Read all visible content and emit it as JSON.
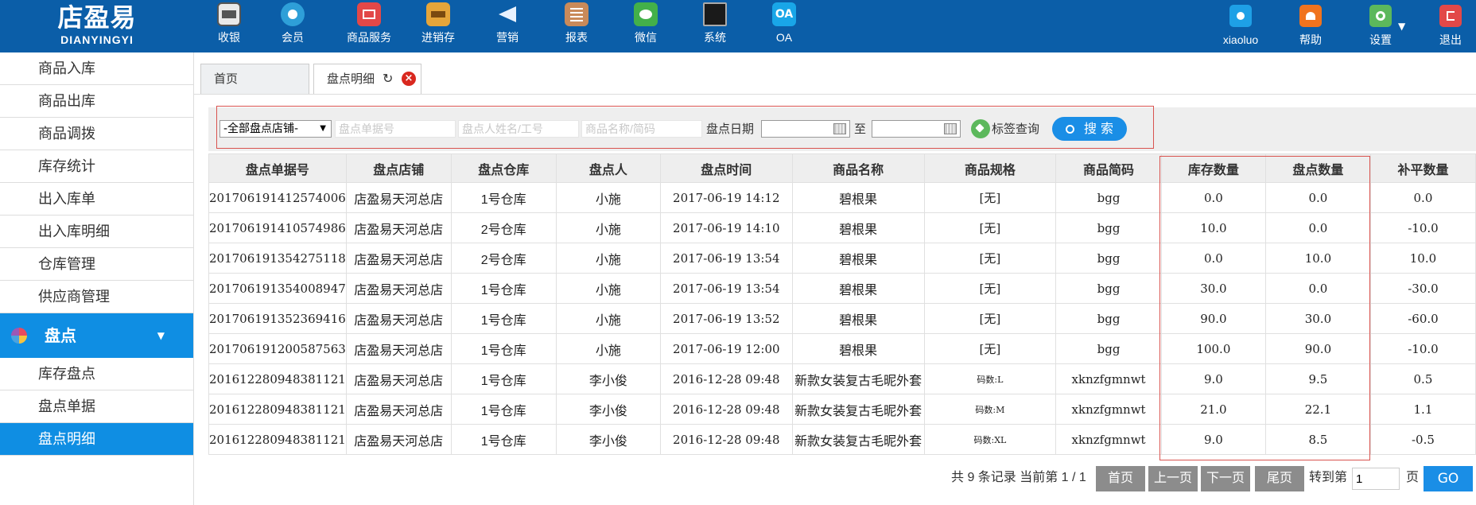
{
  "app": {
    "logo_main": "店盈易",
    "logo_sub": "DIANYINGYI"
  },
  "topnav": [
    {
      "label": "收银",
      "icon": "cash-register-icon"
    },
    {
      "label": "会员",
      "icon": "member-icon"
    },
    {
      "label": "商品服务",
      "icon": "product-service-icon"
    },
    {
      "label": "进销存",
      "icon": "inventory-icon"
    },
    {
      "label": "营销",
      "icon": "megaphone-icon"
    },
    {
      "label": "报表",
      "icon": "report-icon"
    },
    {
      "label": "微信",
      "icon": "wechat-icon"
    },
    {
      "label": "系统",
      "icon": "monitor-icon"
    },
    {
      "label": "OA",
      "icon": "oa-icon",
      "glyph": "OA"
    }
  ],
  "topright": [
    {
      "label": "xiaoluo",
      "icon": "user-icon"
    },
    {
      "label": "帮助",
      "icon": "help-icon"
    },
    {
      "label": "设置",
      "icon": "settings-icon"
    },
    {
      "label": "退出",
      "icon": "logout-icon"
    }
  ],
  "sidebar": {
    "items": [
      "商品入库",
      "商品出库",
      "商品调拨",
      "库存统计",
      "出入库单",
      "出入库明细",
      "仓库管理",
      "供应商管理"
    ],
    "group": "盘点",
    "sub_items": [
      "库存盘点",
      "盘点单据",
      "盘点明细"
    ],
    "active_sub": "盘点明细"
  },
  "tabs": [
    {
      "label": "首页"
    },
    {
      "label": "盘点明细"
    }
  ],
  "filters": {
    "store_select": "-全部盘点店铺-",
    "doc_no_placeholder": "盘点单据号",
    "person_placeholder": "盘点人姓名/工号",
    "product_placeholder": "商品名称/简码",
    "date_label": "盘点日期",
    "to_label": "至",
    "tag_query": "标签查询",
    "search_label": "搜 索"
  },
  "table": {
    "columns": [
      "盘点单据号",
      "盘点店铺",
      "盘点仓库",
      "盘点人",
      "盘点时间",
      "商品名称",
      "商品规格",
      "商品简码",
      "库存数量",
      "盘点数量",
      "补平数量"
    ],
    "rows": [
      [
        "201706191412574006",
        "店盈易天河总店",
        "1号仓库",
        "小施",
        "2017-06-19 14:12",
        "碧根果",
        "[无]",
        "bgg",
        "0.0",
        "0.0",
        "0.0"
      ],
      [
        "201706191410574986",
        "店盈易天河总店",
        "2号仓库",
        "小施",
        "2017-06-19 14:10",
        "碧根果",
        "[无]",
        "bgg",
        "10.0",
        "0.0",
        "-10.0"
      ],
      [
        "201706191354275118",
        "店盈易天河总店",
        "2号仓库",
        "小施",
        "2017-06-19 13:54",
        "碧根果",
        "[无]",
        "bgg",
        "0.0",
        "10.0",
        "10.0"
      ],
      [
        "201706191354008947",
        "店盈易天河总店",
        "1号仓库",
        "小施",
        "2017-06-19 13:54",
        "碧根果",
        "[无]",
        "bgg",
        "30.0",
        "0.0",
        "-30.0"
      ],
      [
        "201706191352369416",
        "店盈易天河总店",
        "1号仓库",
        "小施",
        "2017-06-19 13:52",
        "碧根果",
        "[无]",
        "bgg",
        "90.0",
        "30.0",
        "-60.0"
      ],
      [
        "201706191200587563",
        "店盈易天河总店",
        "1号仓库",
        "小施",
        "2017-06-19 12:00",
        "碧根果",
        "[无]",
        "bgg",
        "100.0",
        "90.0",
        "-10.0"
      ],
      [
        "201612280948381121",
        "店盈易天河总店",
        "1号仓库",
        "李小俊",
        "2016-12-28 09:48",
        "新款女装复古毛昵外套",
        "码数:L",
        "xknzfgmnwt",
        "9.0",
        "9.5",
        "0.5"
      ],
      [
        "201612280948381121",
        "店盈易天河总店",
        "1号仓库",
        "李小俊",
        "2016-12-28 09:48",
        "新款女装复古毛昵外套",
        "码数:M",
        "xknzfgmnwt",
        "21.0",
        "22.1",
        "1.1"
      ],
      [
        "201612280948381121",
        "店盈易天河总店",
        "1号仓库",
        "李小俊",
        "2016-12-28 09:48",
        "新款女装复古毛昵外套",
        "码数:XL",
        "xknzfgmnwt",
        "9.0",
        "8.5",
        "-0.5"
      ]
    ]
  },
  "pager": {
    "summary": "共 9 条记录 当前第 1 / 1",
    "first": "首页",
    "prev": "上一页",
    "next": "下一页",
    "last": "尾页",
    "goto_label": "转到第",
    "page_value": "1",
    "page_unit": "页",
    "go": "GO"
  },
  "colors": {
    "topbar": "#0b5ea8",
    "accent": "#0f8ee3",
    "highlight_border": "#d9534f"
  }
}
